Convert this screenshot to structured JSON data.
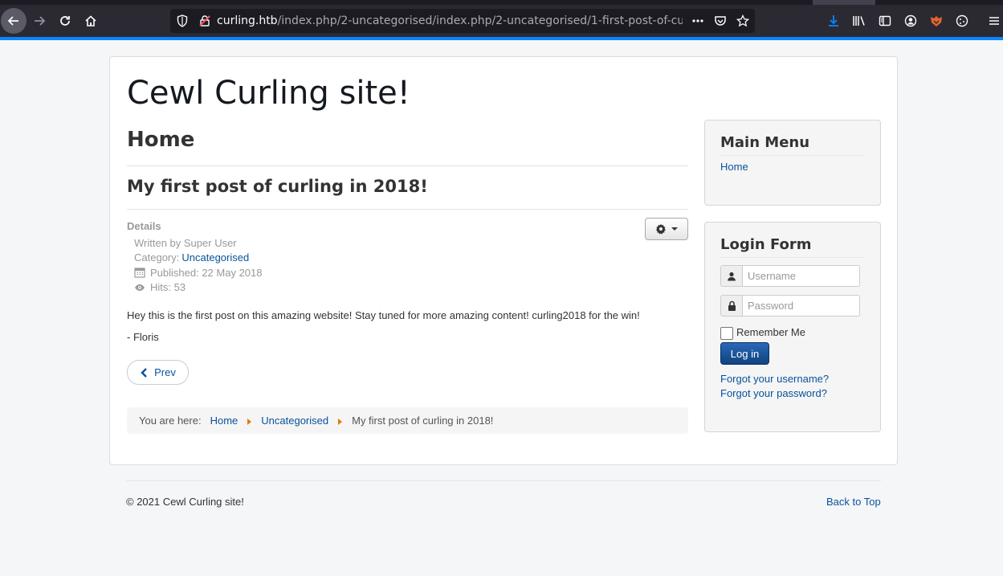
{
  "browser": {
    "url_host": "curling.htb",
    "url_path": "/index.php/2-uncategorised/index.php/2-uncategorised/1-first-post-of-cu",
    "accent_color": "#0a84ff"
  },
  "site": {
    "title": "Cewl Curling site!"
  },
  "main": {
    "page_heading": "Home",
    "article_title": "My first post of curling in 2018!",
    "details": {
      "label": "Details",
      "written_by": "Written by Super User",
      "category_prefix": "Category:",
      "category_link": "Uncategorised",
      "published": "Published: 22 May 2018",
      "hits": "Hits: 53"
    },
    "body": [
      "Hey this is the first post on this amazing website! Stay tuned for more amazing content! curling2018 for the win!",
      "- Floris"
    ],
    "prev_label": "Prev",
    "breadcrumb": {
      "prefix": "You are here:",
      "items": [
        "Home",
        "Uncategorised",
        "My first post of curling in 2018!"
      ]
    }
  },
  "sidebar": {
    "main_menu": {
      "title": "Main Menu",
      "items": [
        "Home"
      ]
    },
    "login": {
      "title": "Login Form",
      "username_placeholder": "Username",
      "password_placeholder": "Password",
      "remember_label": "Remember Me",
      "login_label": "Log in",
      "forgot_username": "Forgot your username?",
      "forgot_password": "Forgot your password?"
    }
  },
  "footer": {
    "copyright": "© 2021 Cewl Curling site!",
    "back_to_top": "Back to Top"
  }
}
